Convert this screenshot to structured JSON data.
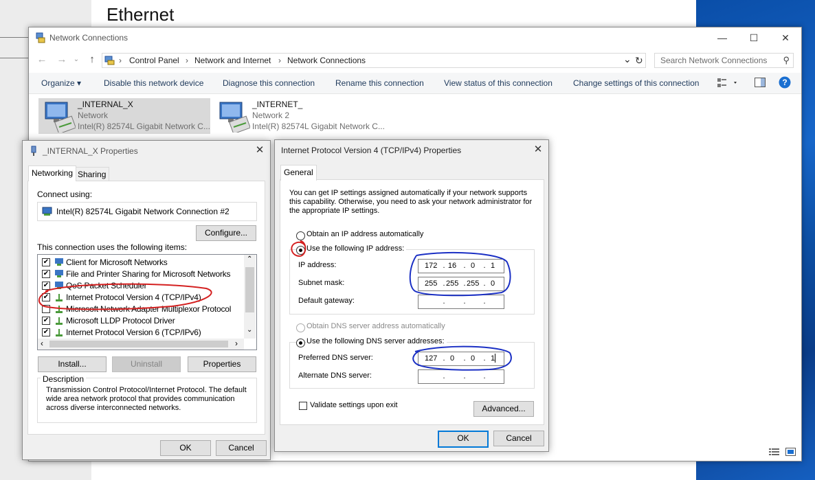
{
  "background": {
    "page_title": "Ethernet"
  },
  "network_connections": {
    "window_title": "Network Connections",
    "breadcrumb": [
      "Control Panel",
      "Network and Internet",
      "Network Connections"
    ],
    "search_placeholder": "Search Network Connections",
    "commands": {
      "organize": "Organize ▾",
      "disable": "Disable this network device",
      "diagnose": "Diagnose this connection",
      "rename": "Rename this connection",
      "view_status": "View status of this connection",
      "change_settings": "Change settings of this connection"
    },
    "adapters": [
      {
        "name": "_INTERNAL_X",
        "network": "Network",
        "device": "Intel(R) 82574L Gigabit Network C..."
      },
      {
        "name": "_INTERNET_",
        "network": "Network 2",
        "device": "Intel(R) 82574L Gigabit Network C..."
      }
    ]
  },
  "adapter_props": {
    "title": "_INTERNAL_X Properties",
    "tabs": [
      "Networking",
      "Sharing"
    ],
    "connect_using_label": "Connect using:",
    "connect_using_value": "Intel(R) 82574L Gigabit Network Connection #2",
    "configure": "Configure...",
    "items_label": "This connection uses the following items:",
    "items": [
      {
        "label": "Client for Microsoft Networks",
        "checked": true
      },
      {
        "label": "File and Printer Sharing for Microsoft Networks",
        "checked": true
      },
      {
        "label": "QoS Packet Scheduler",
        "checked": true
      },
      {
        "label": "Internet Protocol Version 4 (TCP/IPv4)",
        "checked": true
      },
      {
        "label": "Microsoft Network Adapter Multiplexor Protocol",
        "checked": false
      },
      {
        "label": "Microsoft LLDP Protocol Driver",
        "checked": true
      },
      {
        "label": "Internet Protocol Version 6 (TCP/IPv6)",
        "checked": true
      }
    ],
    "install": "Install...",
    "uninstall": "Uninstall",
    "properties": "Properties",
    "description_label": "Description",
    "description": "Transmission Control Protocol/Internet Protocol. The default wide area network protocol that provides communication across diverse interconnected networks.",
    "ok": "OK",
    "cancel": "Cancel"
  },
  "ipv4": {
    "title": "Internet Protocol Version 4 (TCP/IPv4) Properties",
    "tab": "General",
    "intro": "You can get IP settings assigned automatically if your network supports this capability. Otherwise, you need to ask your network administrator for the appropriate IP settings.",
    "obtain_ip_auto": "Obtain an IP address automatically",
    "use_following_ip": "Use the following IP address:",
    "ip_address_label": "IP address:",
    "ip_address": [
      "172",
      "16",
      "0",
      "1"
    ],
    "subnet_label": "Subnet mask:",
    "subnet": [
      "255",
      "255",
      "255",
      "0"
    ],
    "gateway_label": "Default gateway:",
    "obtain_dns_auto": "Obtain DNS server address automatically",
    "use_following_dns": "Use the following DNS server addresses:",
    "preferred_dns_label": "Preferred DNS server:",
    "preferred_dns": [
      "127",
      "0",
      "0",
      "1"
    ],
    "alternate_dns_label": "Alternate DNS server:",
    "validate": "Validate settings upon exit",
    "advanced": "Advanced...",
    "ok": "OK",
    "cancel": "Cancel"
  },
  "colors": {
    "accent": "#0078d7",
    "annotation_red": "#d42020",
    "annotation_blue": "#1a2fc4"
  }
}
